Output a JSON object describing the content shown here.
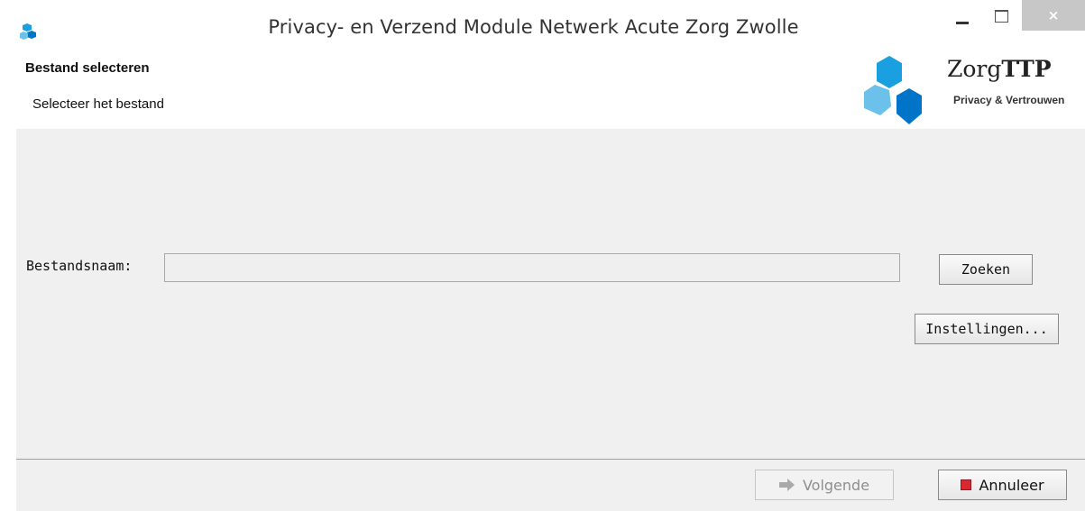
{
  "window": {
    "title": "Privacy- en Verzend Module Netwerk Acute Zorg Zwolle",
    "close_glyph": "×"
  },
  "header": {
    "title": "Bestand selecteren",
    "subtitle": "Selecteer het bestand",
    "logo": {
      "name_regular": "Zorg",
      "name_bold": "TTP",
      "tagline": "Privacy & Vertrouwen",
      "colors": [
        "#1aa0e0",
        "#0074c8",
        "#6cc1ea"
      ]
    }
  },
  "form": {
    "filename_label": "Bestandsnaam:",
    "filename_value": "",
    "search_button": "Zoeken",
    "settings_button": "Instellingen..."
  },
  "footer": {
    "next_button": "Volgende",
    "next_enabled": false,
    "cancel_button": "Annuleer"
  },
  "colors": {
    "accent_blue": "#1aa0e0",
    "cancel_red": "#d9282f",
    "close_button": "#c7c7c7"
  }
}
